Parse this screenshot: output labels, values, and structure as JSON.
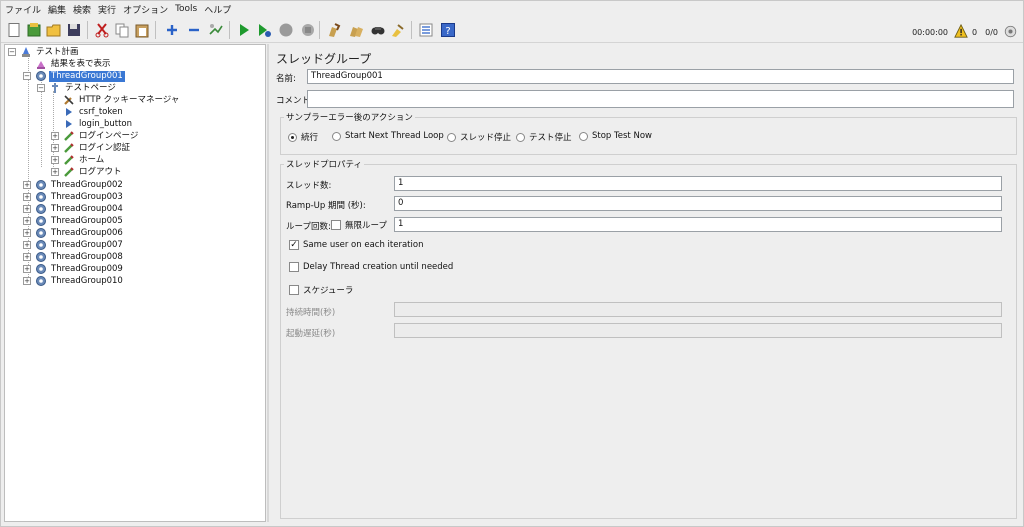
{
  "menubar": [
    "ファイル",
    "編集",
    "検索",
    "実行",
    "オプション",
    "Tools",
    "ヘルプ"
  ],
  "toolbar_status": {
    "elapsed": "00:00:00",
    "warnings": "0",
    "threads": "0/0"
  },
  "tree": {
    "root": "テスト計画",
    "results": "結果を表で表示",
    "selected_group": "ThreadGroup001",
    "test_page": "テストページ",
    "cookie_manager": "HTTP クッキーマネージャ",
    "csrf": "csrf_token",
    "login_button": "login_button",
    "login_page": "ログインページ",
    "login_auth": "ログイン認証",
    "home": "ホーム",
    "logout": "ログアウト",
    "groups": [
      "ThreadGroup002",
      "ThreadGroup003",
      "ThreadGroup004",
      "ThreadGroup005",
      "ThreadGroup006",
      "ThreadGroup007",
      "ThreadGroup008",
      "ThreadGroup009",
      "ThreadGroup010"
    ]
  },
  "panel": {
    "title": "スレッドグループ",
    "name_label": "名前:",
    "name_value": "ThreadGroup001",
    "comment_label": "コメント:",
    "comment_value": "",
    "sampler_error_title": "サンプラーエラー後のアクション",
    "actions": [
      "続行",
      "Start Next Thread Loop",
      "スレッド停止",
      "テスト停止",
      "Stop Test Now"
    ],
    "selected_action": "続行",
    "props_title": "スレッドプロパティ",
    "threads_label": "スレッド数:",
    "threads_value": "1",
    "rampup_label": "Ramp-Up 期間 (秒):",
    "rampup_value": "0",
    "loop_label": "ループ回数:",
    "infinite_label": "無限ループ",
    "loop_value": "1",
    "same_user_label": "Same user on each iteration",
    "same_user_checked": true,
    "delay_label": "Delay Thread creation until needed",
    "delay_checked": false,
    "scheduler_label": "スケジューラ",
    "scheduler_checked": false,
    "duration_label": "持続時間(秒)",
    "startup_label": "起動遅延(秒)"
  }
}
